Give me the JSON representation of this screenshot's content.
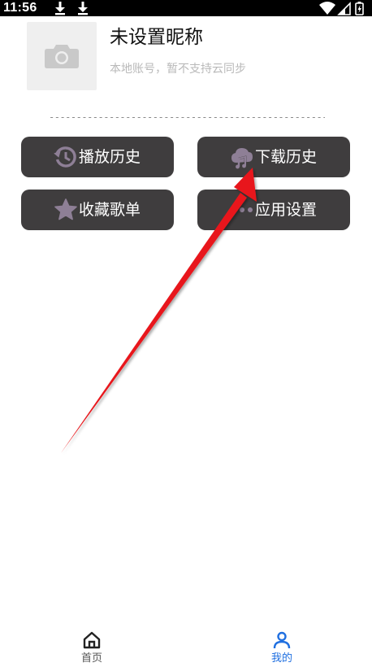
{
  "status_bar": {
    "time": "11:56",
    "icons": [
      "download-icon",
      "download-icon",
      "wifi-icon",
      "signal-icon",
      "battery-charging-icon"
    ]
  },
  "profile": {
    "avatar_icon": "camera-icon",
    "nickname": "未设置昵称",
    "subtitle": "本地账号，暂不支持云同步",
    "separator": "------------------------------------------------------------"
  },
  "actions": {
    "play_history": {
      "label": "播放历史",
      "icon": "history-icon"
    },
    "download_history": {
      "label": "下载历史",
      "icon": "cloud-music-icon"
    },
    "favorites": {
      "label": "收藏歌单",
      "icon": "star-icon"
    },
    "settings": {
      "label": "应用设置",
      "icon": "more-icon"
    }
  },
  "annotation": {
    "type": "red-arrow",
    "points_to": "download_history",
    "color": "#e8191b"
  },
  "bottom_nav": {
    "items": [
      {
        "label": "首页",
        "icon": "home-icon",
        "active": false
      },
      {
        "label": "我的",
        "icon": "person-icon",
        "active": true
      }
    ]
  },
  "colors": {
    "button_bg": "#3f3d3e",
    "icon_muted": "#8e7f96",
    "accent": "#1f6fe0"
  }
}
